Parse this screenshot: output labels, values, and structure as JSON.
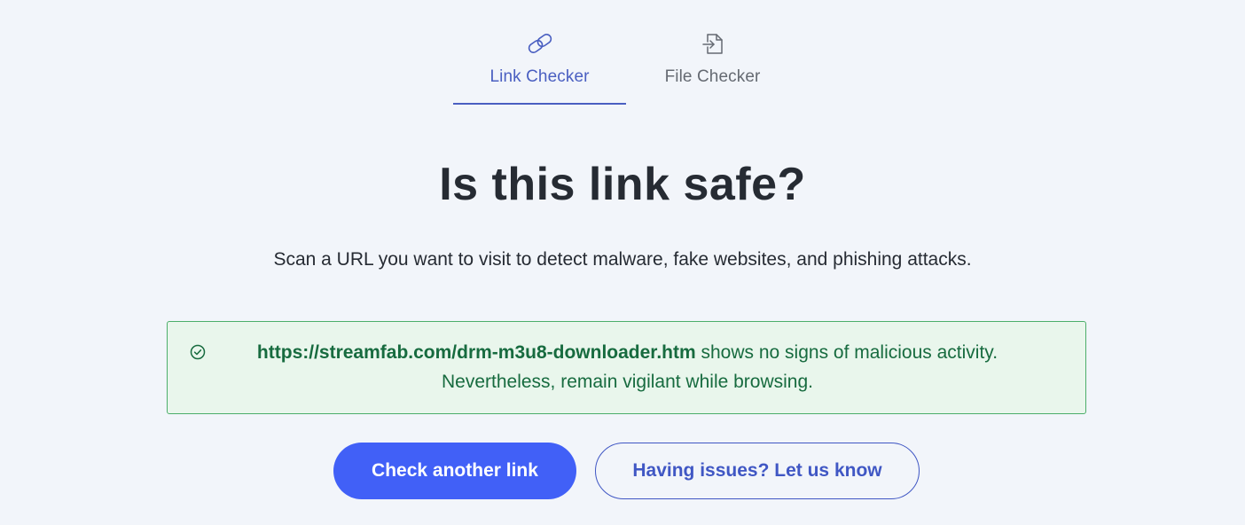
{
  "tabs": [
    {
      "label": "Link Checker",
      "icon": "link-icon",
      "active": true
    },
    {
      "label": "File Checker",
      "icon": "file-import-icon",
      "active": false
    }
  ],
  "heading": {
    "title": "Is this link safe?",
    "subtitle": "Scan a URL you want to visit to detect malware, fake websites, and phishing attacks."
  },
  "result": {
    "icon": "check-circle-icon",
    "url": "https://streamfab.com/drm-m3u8-downloader.htm",
    "message": " shows no signs of malicious activity.",
    "advice": "Nevertheless, remain vigilant while browsing."
  },
  "buttons": {
    "check_another": "Check another link",
    "report_issue": "Having issues? Let us know"
  },
  "colors": {
    "accent": "#4a5fc1",
    "primary_button": "#4160f7",
    "success_text": "#176b3f",
    "success_bg": "#e9f6ec",
    "success_border": "#4cae6a",
    "background": "#f2f5fa"
  }
}
